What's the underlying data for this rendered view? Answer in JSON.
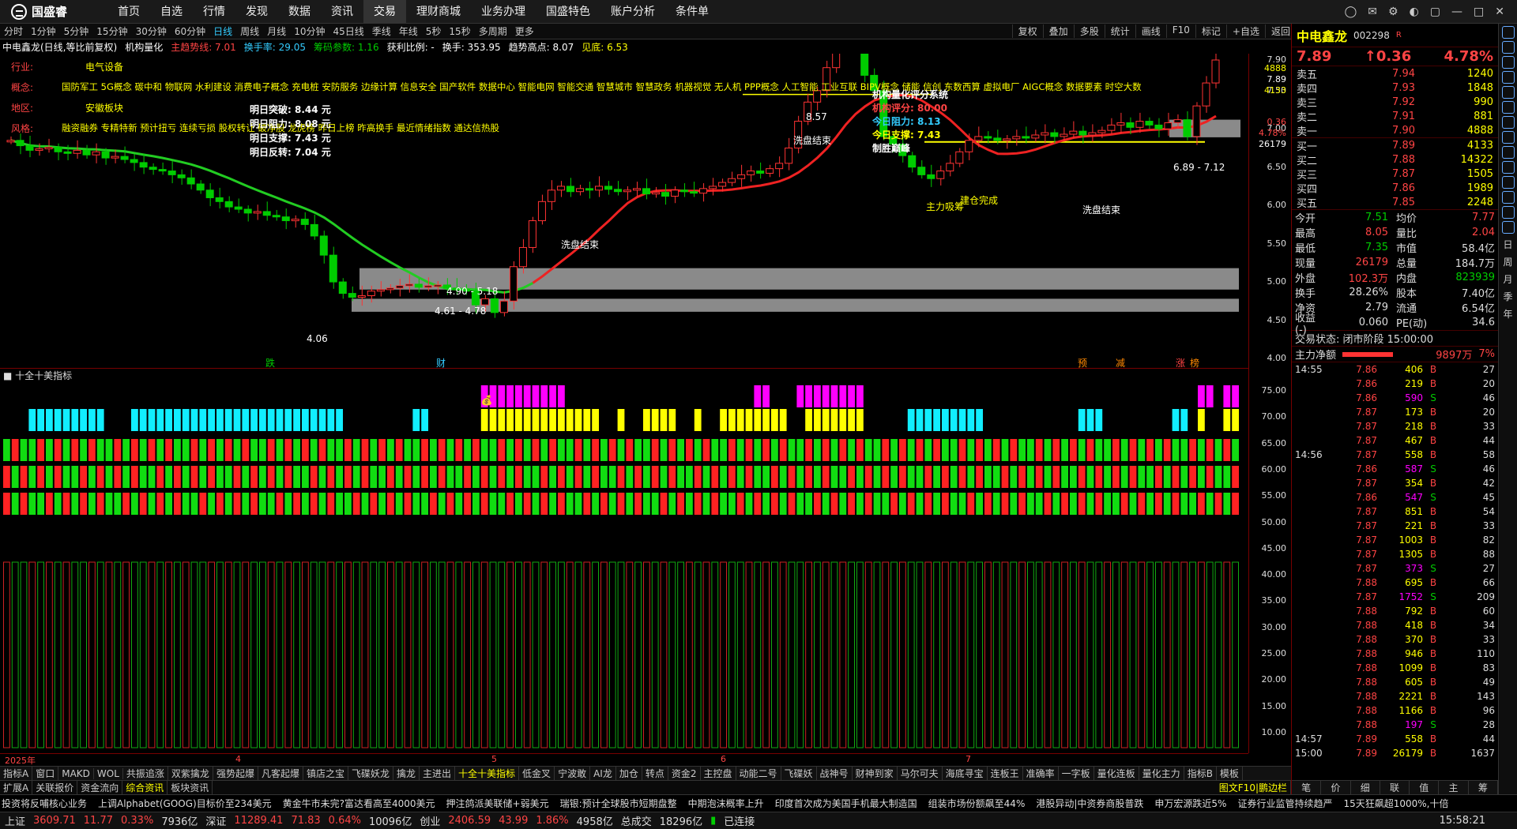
{
  "app": {
    "logo": "国盛睿"
  },
  "menu": [
    "首页",
    "自选",
    "行情",
    "发现",
    "数据",
    "资讯",
    "交易",
    "理财商城",
    "业务办理",
    "国盛特色",
    "账户分析",
    "条件单"
  ],
  "menu_active": "交易",
  "periods": [
    "分时",
    "1分钟",
    "5分钟",
    "15分钟",
    "30分钟",
    "60分钟",
    "日线",
    "周线",
    "月线",
    "10分钟",
    "45日线",
    "季线",
    "年线",
    "5秒",
    "15秒",
    "多周期",
    "更多"
  ],
  "periods_active": "日线",
  "toolbar_right": [
    "复权",
    "叠加",
    "多股",
    "统计",
    "画线",
    "F10",
    "标记",
    "+自选",
    "返回"
  ],
  "info": {
    "title": "中电鑫龙(日线,等比前复权)",
    "indicator": "机构量化",
    "trend": "主趋势线: 7.01",
    "turnover": "换手率: 29.05",
    "chips": "筹码参数: 1.16",
    "profit": "获利比例: -",
    "turn2": "换手: 353.95",
    "high": "趋势高点: 8.07",
    "peak": "见底: 6.53"
  },
  "tags": {
    "industry_k": "行业:",
    "industry_v": "电气设备",
    "concept_k": "概念:",
    "concept_v": "国防军工 5G概念 碳中和 物联网 水利建设 消费电子概念 充电桩 安防服务 边缘计算 信息安全 国产软件 数据中心 智能电网 智能交通 智慧城市 智慧政务 机器视觉 无人机 PPP概念 人工智能 工业互联 BIPV概念 储能 信创 东数西算 虚拟电厂 AIGC概念 数据要素 时空大数",
    "region_k": "地区:",
    "region_v": "安徽板块",
    "style_k": "风格:",
    "style_v": "融资融券 专精特新 预计扭亏 连续亏损 股权转让 破净股 龙虎榜 昨日上榜 昨高换手 最近情绪指数 通达信热股"
  },
  "tomorrow": {
    "breakout": "明日突破: 8.44 元",
    "resist": "明日阻力: 8.08 元",
    "support": "明日支撑: 7.43 元",
    "reverse": "明日反转: 7.04 元"
  },
  "score": {
    "title": "机构量化评分系统",
    "score": "机构评分: 80.00",
    "resist": "今日阻力: 8.13",
    "support": "今日支撑: 7.43",
    "state": "制胜巅峰"
  },
  "annotations": {
    "wash1": "洗盘结束",
    "wash2": "洗盘结束",
    "wash3": "洗盘结束",
    "absorb": "主力吸筹",
    "build": "建仓完成",
    "high": "8.57",
    "low": "4.06",
    "zone1": "4.90 - 5.18",
    "zone2": "4.61 - 4.78",
    "zone3": "6.89 - 7.12",
    "m_die": "跌",
    "m_cai": "财",
    "m_yu": "预",
    "m_jian": "减",
    "m_zhang": "涨",
    "m_bang": "榜"
  },
  "chart_data": {
    "type": "candlestick",
    "ylim": [
      4.0,
      7.9
    ],
    "yticks": [
      "7.90",
      "7.89",
      "7.50",
      "7.00",
      "6.50",
      "6.00",
      "5.50",
      "5.00",
      "4.50",
      "4.00"
    ],
    "ytick_extra": [
      "4888",
      "4133",
      "0.36",
      "4.78%",
      "26179",
      "7.89"
    ],
    "ind_yticks": [
      "75.00",
      "70.00",
      "65.00",
      "60.00",
      "55.00",
      "50.00",
      "45.00",
      "40.00",
      "35.00",
      "30.00",
      "25.00",
      "20.00",
      "15.00",
      "10.00"
    ],
    "date_labels": [
      "2025年",
      "4",
      "5",
      "6",
      "7"
    ]
  },
  "indicator_title": "十全十美指标",
  "tabs1": [
    "指标A",
    "窗口",
    "MAKD",
    "WOL",
    "共振追涨",
    "双紫擒龙",
    "强势起爆",
    "凡客起爆",
    "镇店之宝",
    "飞碟妖龙",
    "擒龙",
    "主进出",
    "十全十美指标",
    "低金叉",
    "宁波敢",
    "AI龙",
    "加仓",
    "转点",
    "资金2",
    "主控盘",
    "动能二号",
    "飞碟妖",
    "战神号",
    "财神到家",
    "马尔可夫",
    "海底寻宝",
    "连板王",
    "准确率",
    "一字板",
    "量化连板",
    "量化主力",
    "指标B",
    "模板"
  ],
  "tabs1_active": "十全十美指标",
  "tabs2": [
    "扩展A",
    "关联报价",
    "资金流向",
    "综合资讯",
    "板块资讯"
  ],
  "tabs2_right": "图文F10|鹏边栏",
  "tabs2_active": "综合资讯",
  "ticker": [
    "投资将反哺核心业务",
    "上调Alphabet(GOOG)目标价至234美元",
    "黄金牛市未完?富达看高至4000美元",
    "押注鸽派美联储+弱美元",
    "瑞银:预计全球股市短期盘整",
    "中期泡沫概率上升",
    "印度首次成为美国手机最大制造国",
    "组装市场份额飙至44%",
    "港股异动|中资券商股普跌",
    "申万宏源跌近5%",
    "证券行业监管持续趋严",
    "15天狂飙超1000%,十倍"
  ],
  "status": {
    "sh_k": "上证",
    "sh": "3609.71",
    "sh_c": "11.77",
    "sh_p": "0.33%",
    "sh_a": "7936亿",
    "sz_k": "深证",
    "sz": "11289.41",
    "sz_c": "71.83",
    "sz_p": "0.64%",
    "sz_a": "10096亿",
    "cy_k": "创业",
    "cy": "2406.59",
    "cy_c": "43.99",
    "cy_p": "1.86%",
    "cy_a": "4958亿",
    "tot_k": "总成交",
    "tot": "18296亿",
    "conn": "已连接",
    "time": "15:58:21"
  },
  "quote": {
    "name": "中电鑫龙",
    "code": "002298",
    "badge": "R",
    "price": "7.89",
    "chg": "↑0.36",
    "pct": "4.78%"
  },
  "sells": [
    {
      "l": "卖五",
      "p": "7.94",
      "q": "1240"
    },
    {
      "l": "卖四",
      "p": "7.93",
      "q": "1848"
    },
    {
      "l": "卖三",
      "p": "7.92",
      "q": "990"
    },
    {
      "l": "卖二",
      "p": "7.91",
      "q": "881"
    },
    {
      "l": "卖一",
      "p": "7.90",
      "q": "4888"
    }
  ],
  "buys": [
    {
      "l": "买一",
      "p": "7.89",
      "q": "4133"
    },
    {
      "l": "买二",
      "p": "7.88",
      "q": "14322"
    },
    {
      "l": "买三",
      "p": "7.87",
      "q": "1505"
    },
    {
      "l": "买四",
      "p": "7.86",
      "q": "1989"
    },
    {
      "l": "买五",
      "p": "7.85",
      "q": "2248"
    }
  ],
  "stats": [
    {
      "a": "今开",
      "b": "7.51",
      "bc": "#0c0",
      "c": "均价",
      "d": "7.77",
      "dc": "#f44"
    },
    {
      "a": "最高",
      "b": "8.05",
      "bc": "#f44",
      "c": "量比",
      "d": "2.04",
      "dc": "#f44"
    },
    {
      "a": "最低",
      "b": "7.35",
      "bc": "#0c0",
      "c": "市值",
      "d": "58.4亿",
      "dc": "#ddd"
    },
    {
      "a": "现量",
      "b": "26179",
      "bc": "#f44",
      "c": "总量",
      "d": "184.7万",
      "dc": "#ddd"
    },
    {
      "a": "外盘",
      "b": "102.3万",
      "bc": "#f44",
      "c": "内盘",
      "d": "823939",
      "dc": "#0c0"
    },
    {
      "a": "换手",
      "b": "28.26%",
      "bc": "#ddd",
      "c": "股本",
      "d": "7.40亿",
      "dc": "#ddd"
    },
    {
      "a": "净资",
      "b": "2.79",
      "bc": "#ddd",
      "c": "流通",
      "d": "6.54亿",
      "dc": "#ddd"
    },
    {
      "a": "收益(-)",
      "b": "0.060",
      "bc": "#ddd",
      "c": "PE(动)",
      "d": "34.6",
      "dc": "#ddd"
    }
  ],
  "trade_state": "交易状态: 闭市阶段 15:00:00",
  "mainflow": {
    "label": "主力净额",
    "val": "9897万",
    "pct": "7%"
  },
  "ticks": [
    {
      "t": "14:55",
      "p": "7.86",
      "v": "406",
      "bs": "B",
      "n": "27"
    },
    {
      "t": "",
      "p": "7.86",
      "v": "219",
      "bs": "B",
      "n": "20"
    },
    {
      "t": "",
      "p": "7.86",
      "v": "590",
      "bs": "S",
      "n": "46"
    },
    {
      "t": "",
      "p": "7.87",
      "v": "173",
      "bs": "B",
      "n": "20"
    },
    {
      "t": "",
      "p": "7.87",
      "v": "218",
      "bs": "B",
      "n": "33"
    },
    {
      "t": "",
      "p": "7.87",
      "v": "467",
      "bs": "B",
      "n": "44"
    },
    {
      "t": "14:56",
      "p": "7.87",
      "v": "558",
      "bs": "B",
      "n": "58"
    },
    {
      "t": "",
      "p": "7.86",
      "v": "587",
      "bs": "S",
      "n": "46"
    },
    {
      "t": "",
      "p": "7.87",
      "v": "354",
      "bs": "B",
      "n": "42"
    },
    {
      "t": "",
      "p": "7.86",
      "v": "547",
      "bs": "S",
      "n": "45"
    },
    {
      "t": "",
      "p": "7.87",
      "v": "851",
      "bs": "B",
      "n": "54"
    },
    {
      "t": "",
      "p": "7.87",
      "v": "221",
      "bs": "B",
      "n": "33"
    },
    {
      "t": "",
      "p": "7.87",
      "v": "1003",
      "bs": "B",
      "n": "82"
    },
    {
      "t": "",
      "p": "7.87",
      "v": "1305",
      "bs": "B",
      "n": "88"
    },
    {
      "t": "",
      "p": "7.87",
      "v": "373",
      "bs": "S",
      "n": "27"
    },
    {
      "t": "",
      "p": "7.88",
      "v": "695",
      "bs": "B",
      "n": "66"
    },
    {
      "t": "",
      "p": "7.87",
      "v": "1752",
      "bs": "S",
      "n": "209"
    },
    {
      "t": "",
      "p": "7.88",
      "v": "792",
      "bs": "B",
      "n": "60"
    },
    {
      "t": "",
      "p": "7.88",
      "v": "418",
      "bs": "B",
      "n": "34"
    },
    {
      "t": "",
      "p": "7.88",
      "v": "370",
      "bs": "B",
      "n": "33"
    },
    {
      "t": "",
      "p": "7.88",
      "v": "946",
      "bs": "B",
      "n": "110"
    },
    {
      "t": "",
      "p": "7.88",
      "v": "1099",
      "bs": "B",
      "n": "83"
    },
    {
      "t": "",
      "p": "7.88",
      "v": "605",
      "bs": "B",
      "n": "49"
    },
    {
      "t": "",
      "p": "7.88",
      "v": "2221",
      "bs": "B",
      "n": "143"
    },
    {
      "t": "",
      "p": "7.88",
      "v": "1166",
      "bs": "B",
      "n": "96"
    },
    {
      "t": "",
      "p": "7.88",
      "v": "197",
      "bs": "S",
      "n": "28"
    },
    {
      "t": "14:57",
      "p": "7.89",
      "v": "558",
      "bs": "B",
      "n": "44"
    },
    {
      "t": "15:00",
      "p": "7.89",
      "v": "26179",
      "bs": "B",
      "n": "1637"
    }
  ],
  "rp_bottom": [
    "笔",
    "价",
    "细",
    "联",
    "值",
    "主",
    "筹"
  ],
  "sidebar": [
    "日",
    "周",
    "月",
    "季",
    "年"
  ]
}
